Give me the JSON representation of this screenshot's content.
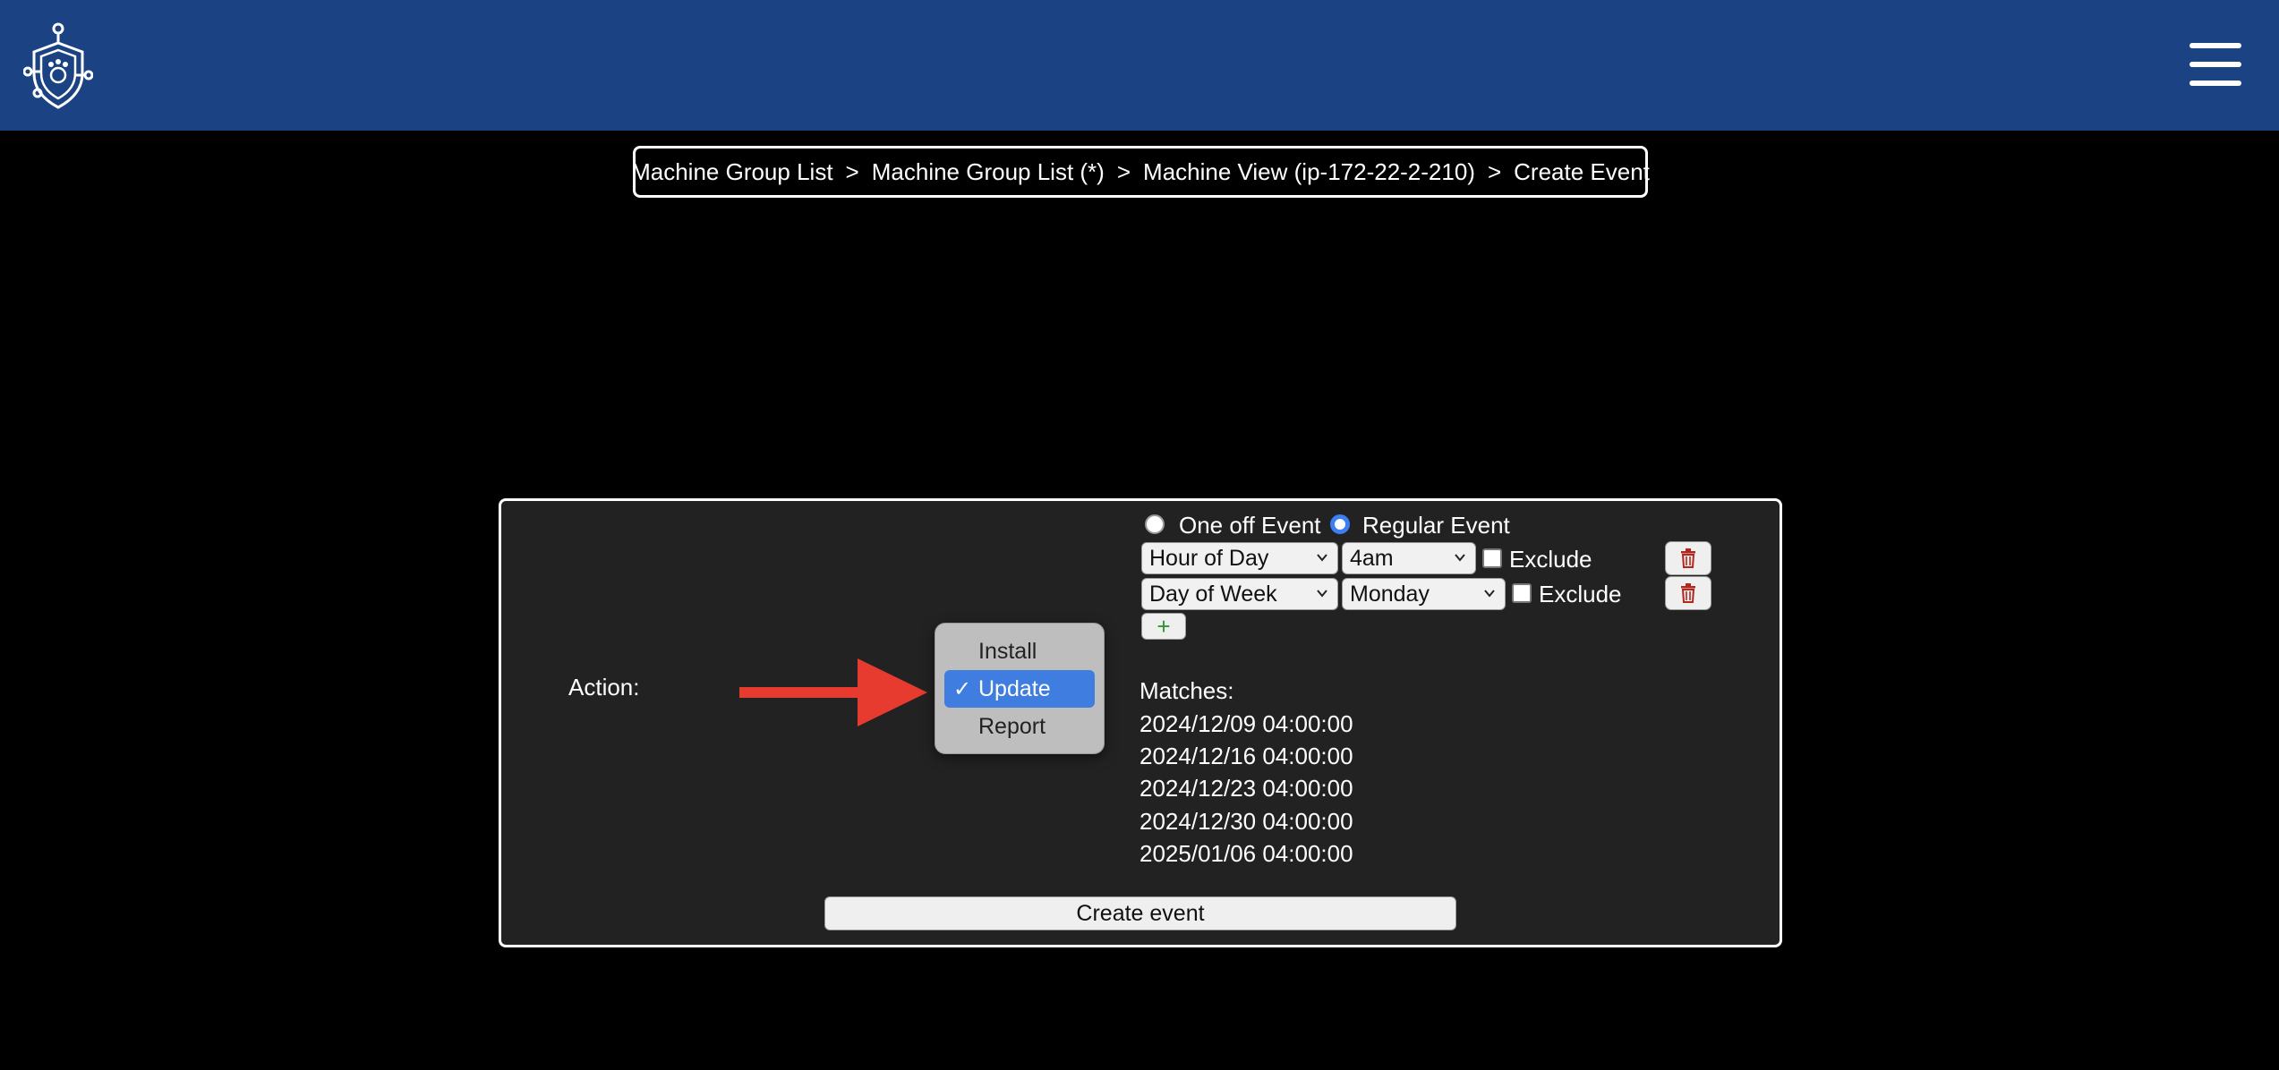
{
  "header": {
    "logo_icon": "shield-paw-logo-icon",
    "menu_icon": "hamburger-menu-icon",
    "bg_color": "#1b4283"
  },
  "breadcrumb": {
    "items": [
      "Machine Group List",
      "Machine Group List (*)",
      "Machine View (ip-172-22-2-210)",
      "Create Event"
    ],
    "separator": ">"
  },
  "form": {
    "action_label": "Action:",
    "action_options": [
      "Install",
      "Update",
      "Report"
    ],
    "action_selected": "Update",
    "event_type_options": [
      "One off Event",
      "Regular Event"
    ],
    "event_type_selected": "Regular Event",
    "rules": [
      {
        "field": "Hour of Day",
        "value": "4am",
        "exclude_label": "Exclude",
        "exclude_checked": false
      },
      {
        "field": "Day of Week",
        "value": "Monday",
        "exclude_label": "Exclude",
        "exclude_checked": false
      }
    ],
    "add_rule_label": "+",
    "matches_label": "Matches:",
    "matches": [
      "2024/12/09 04:00:00",
      "2024/12/16 04:00:00",
      "2024/12/23 04:00:00",
      "2024/12/30 04:00:00",
      "2025/01/06 04:00:00"
    ],
    "submit_label": "Create event"
  },
  "annotation": {
    "arrow_color": "#e63b2e",
    "arrow_icon": "red-arrow-pointer-icon"
  }
}
